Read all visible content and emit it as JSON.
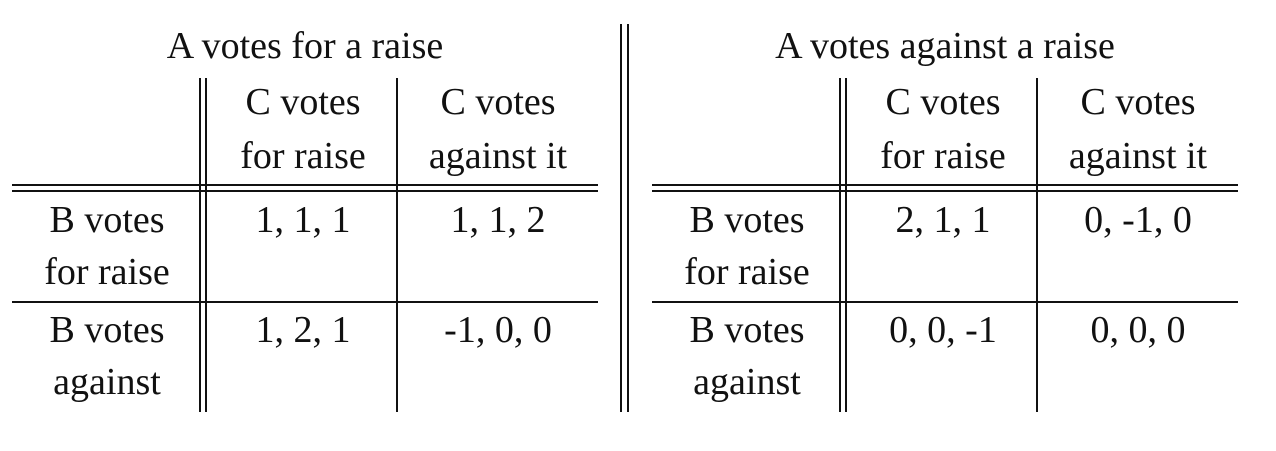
{
  "games": [
    {
      "title": "A votes for a raise",
      "col_headers": [
        [
          "C votes",
          "for raise"
        ],
        [
          "C votes",
          "against it"
        ]
      ],
      "rows": [
        {
          "label": [
            "B votes",
            "for raise"
          ],
          "cells": [
            "1, 1, 1",
            "1, 1, 2"
          ]
        },
        {
          "label": [
            "B votes",
            "against"
          ],
          "cells": [
            "1, 2, 1",
            "-1, 0, 0"
          ]
        }
      ]
    },
    {
      "title": "A votes against a raise",
      "col_headers": [
        [
          "C votes",
          "for raise"
        ],
        [
          "C votes",
          "against it"
        ]
      ],
      "rows": [
        {
          "label": [
            "B votes",
            "for raise"
          ],
          "cells": [
            "2, 1, 1",
            "0, -1, 0"
          ]
        },
        {
          "label": [
            "B votes",
            "against"
          ],
          "cells": [
            "0, 0, -1",
            "0, 0, 0"
          ]
        }
      ]
    }
  ]
}
